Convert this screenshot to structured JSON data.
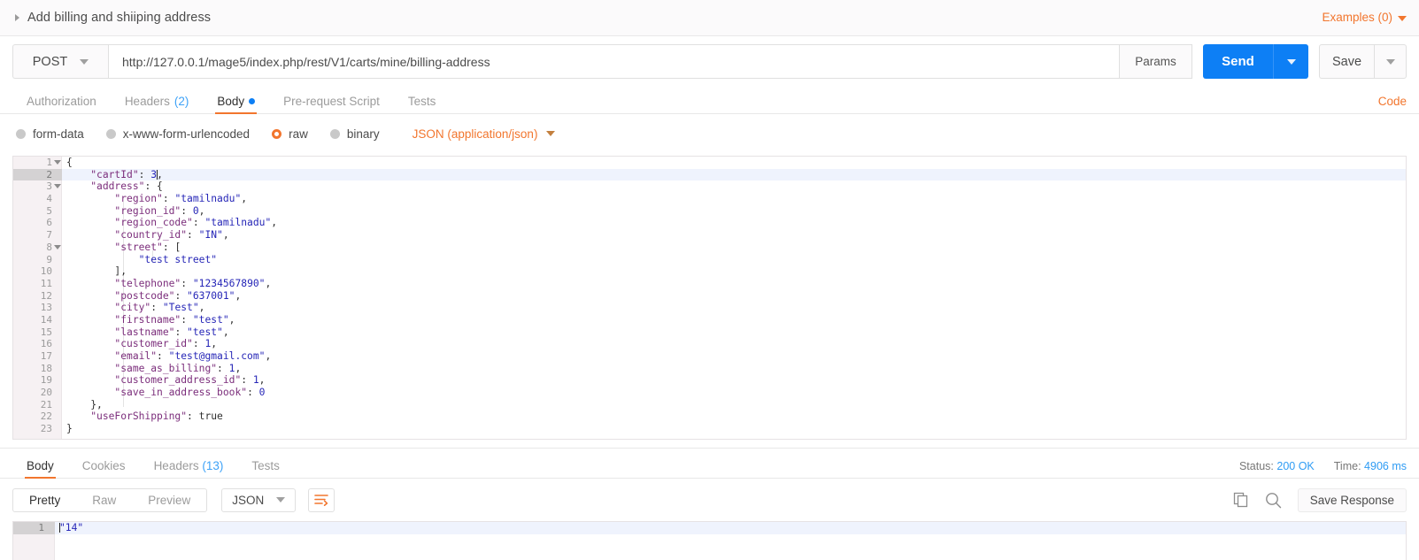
{
  "header": {
    "request_title": "Add billing and shiiping address",
    "examples_label": "Examples (0)",
    "collapse_icon": "triangle-right-icon",
    "examples_caret_icon": "chevron-down-icon"
  },
  "url_bar": {
    "method": "POST",
    "method_caret_icon": "chevron-down-icon",
    "url": "http://127.0.0.1/mage5/index.php/rest/V1/carts/mine/billing-address",
    "url_placeholder": "Enter request URL",
    "params_label": "Params",
    "send_label": "Send",
    "send_caret_icon": "chevron-down-icon",
    "save_label": "Save",
    "save_caret_icon": "chevron-down-icon",
    "send_color": "#0d7ff5"
  },
  "request_tabs": {
    "items": [
      {
        "label": "Authorization",
        "count": "",
        "active": false,
        "dot": false
      },
      {
        "label": "Headers",
        "count": "(2)",
        "active": false,
        "dot": false
      },
      {
        "label": "Body",
        "count": "",
        "active": true,
        "dot": true
      },
      {
        "label": "Pre-request Script",
        "count": "",
        "active": false,
        "dot": false
      },
      {
        "label": "Tests",
        "count": "",
        "active": false,
        "dot": false
      }
    ],
    "code_label": "Code",
    "accent_color": "#f2762e"
  },
  "body_types": {
    "options": [
      {
        "label": "form-data",
        "selected": false
      },
      {
        "label": "x-www-form-urlencoded",
        "selected": false
      },
      {
        "label": "raw",
        "selected": true
      },
      {
        "label": "binary",
        "selected": false
      }
    ],
    "content_type": "JSON (application/json)",
    "content_type_caret_icon": "chevron-down-icon"
  },
  "request_body": {
    "lines": [
      {
        "num": "1",
        "fold": true,
        "indent": 0,
        "text": "{",
        "active": false
      },
      {
        "num": "2",
        "fold": false,
        "indent": 0,
        "text": "    \"cartId\": 3,",
        "active": true
      },
      {
        "num": "3",
        "fold": true,
        "indent": 0,
        "text": "    \"address\": {",
        "active": false
      },
      {
        "num": "4",
        "fold": false,
        "indent": 0,
        "text": "        \"region\": \"tamilnadu\",",
        "active": false
      },
      {
        "num": "5",
        "fold": false,
        "indent": 0,
        "text": "        \"region_id\": 0,",
        "active": false
      },
      {
        "num": "6",
        "fold": false,
        "indent": 0,
        "text": "        \"region_code\": \"tamilnadu\",",
        "active": false
      },
      {
        "num": "7",
        "fold": false,
        "indent": 0,
        "text": "        \"country_id\": \"IN\",",
        "active": false
      },
      {
        "num": "8",
        "fold": true,
        "indent": 0,
        "text": "        \"street\": [",
        "active": false
      },
      {
        "num": "9",
        "fold": false,
        "indent": 0,
        "text": "            \"test street\"",
        "active": false
      },
      {
        "num": "10",
        "fold": false,
        "indent": 0,
        "text": "        ],",
        "active": false
      },
      {
        "num": "11",
        "fold": false,
        "indent": 0,
        "text": "        \"telephone\": \"1234567890\",",
        "active": false
      },
      {
        "num": "12",
        "fold": false,
        "indent": 0,
        "text": "        \"postcode\": \"637001\",",
        "active": false
      },
      {
        "num": "13",
        "fold": false,
        "indent": 0,
        "text": "        \"city\": \"Test\",",
        "active": false
      },
      {
        "num": "14",
        "fold": false,
        "indent": 0,
        "text": "        \"firstname\": \"test\",",
        "active": false
      },
      {
        "num": "15",
        "fold": false,
        "indent": 0,
        "text": "        \"lastname\": \"test\",",
        "active": false
      },
      {
        "num": "16",
        "fold": false,
        "indent": 0,
        "text": "        \"customer_id\": 1,",
        "active": false
      },
      {
        "num": "17",
        "fold": false,
        "indent": 0,
        "text": "        \"email\": \"test@gmail.com\",",
        "active": false
      },
      {
        "num": "18",
        "fold": false,
        "indent": 0,
        "text": "        \"same_as_billing\": 1,",
        "active": false
      },
      {
        "num": "19",
        "fold": false,
        "indent": 0,
        "text": "        \"customer_address_id\": 1,",
        "active": false
      },
      {
        "num": "20",
        "fold": false,
        "indent": 0,
        "text": "        \"save_in_address_book\": 0",
        "active": false
      },
      {
        "num": "21",
        "fold": false,
        "indent": 0,
        "text": "    },",
        "active": false
      },
      {
        "num": "22",
        "fold": false,
        "indent": 0,
        "text": "    \"useForShipping\": true",
        "active": false
      },
      {
        "num": "23",
        "fold": false,
        "indent": 0,
        "text": "}",
        "active": false
      }
    ]
  },
  "response_tabs": {
    "items": [
      {
        "label": "Body",
        "count": "",
        "active": true
      },
      {
        "label": "Cookies",
        "count": "",
        "active": false
      },
      {
        "label": "Headers",
        "count": "(13)",
        "active": false
      },
      {
        "label": "Tests",
        "count": "",
        "active": false
      }
    ],
    "status_label": "Status:",
    "status_value": "200 OK",
    "time_label": "Time:",
    "time_value": "4906 ms",
    "value_color": "#2f9cf4"
  },
  "response_toolbar": {
    "views": [
      {
        "label": "Pretty",
        "active": true
      },
      {
        "label": "Raw",
        "active": false
      },
      {
        "label": "Preview",
        "active": false
      }
    ],
    "format": "JSON",
    "format_caret_icon": "chevron-down-icon",
    "wrap_icon": "word-wrap-icon",
    "copy_icon": "copy-icon",
    "search_icon": "search-icon",
    "save_response_label": "Save Response"
  },
  "response_body": {
    "lines": [
      {
        "num": "1",
        "text": "\"14\""
      }
    ]
  }
}
